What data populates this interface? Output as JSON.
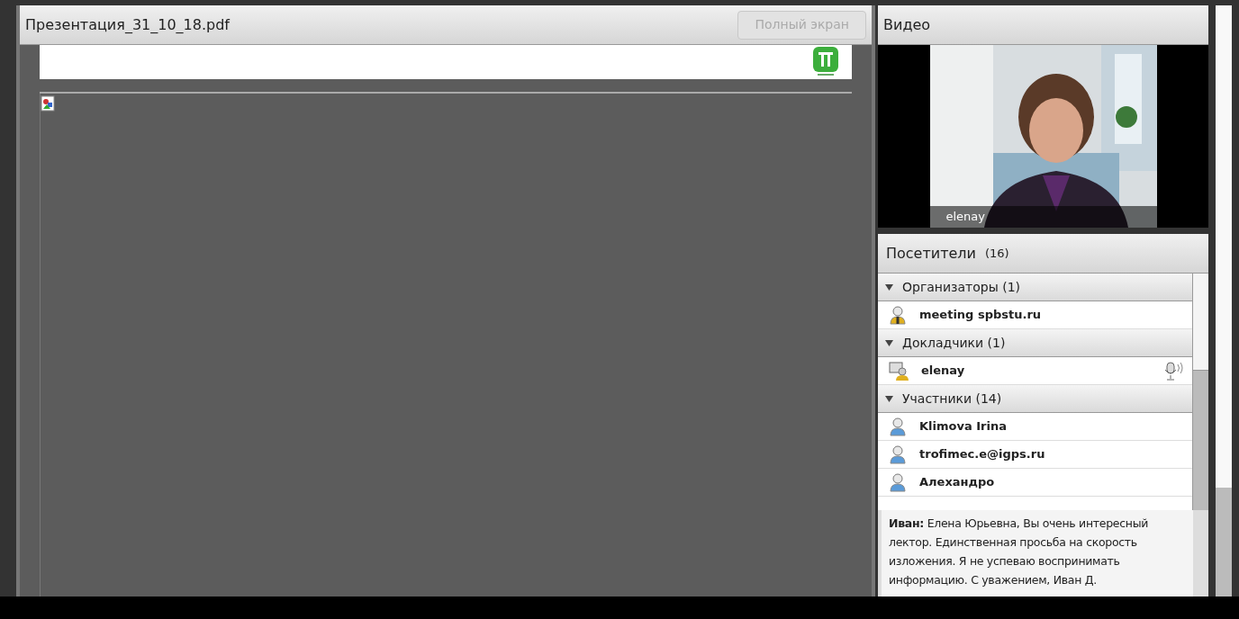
{
  "document_pod": {
    "title": "Презентация_31_10_18.pdf",
    "fullscreen_button": {
      "label": "Полный экран",
      "disabled": true
    }
  },
  "video_pod": {
    "title": "Видео",
    "camera_label": "elenay"
  },
  "attendees_pod": {
    "title": "Посетители",
    "count": "(16)",
    "groups": [
      {
        "label": "Организаторы (1)",
        "expanded": true,
        "people": [
          {
            "name": "meeting spbstu.ru",
            "kind": "host",
            "speaking": false
          }
        ]
      },
      {
        "label": "Докладчики (1)",
        "expanded": true,
        "people": [
          {
            "name": "elenay",
            "kind": "presenter",
            "speaking": true
          }
        ]
      },
      {
        "label": "Участники (14)",
        "expanded": true,
        "people": [
          {
            "name": "Klimova Irina",
            "kind": "participant",
            "speaking": false
          },
          {
            "name": "trofimec.e@igps.ru",
            "kind": "participant",
            "speaking": false
          },
          {
            "name": "Алехандро",
            "kind": "participant",
            "speaking": false
          }
        ]
      }
    ]
  },
  "chat": {
    "message": "**Иван:** Елена Юрьевна, Вы очень интересный лектор. Единственная просьба на скорость изложения. Я не успеваю воспринимать информацию. С уважением, Иван Д."
  }
}
